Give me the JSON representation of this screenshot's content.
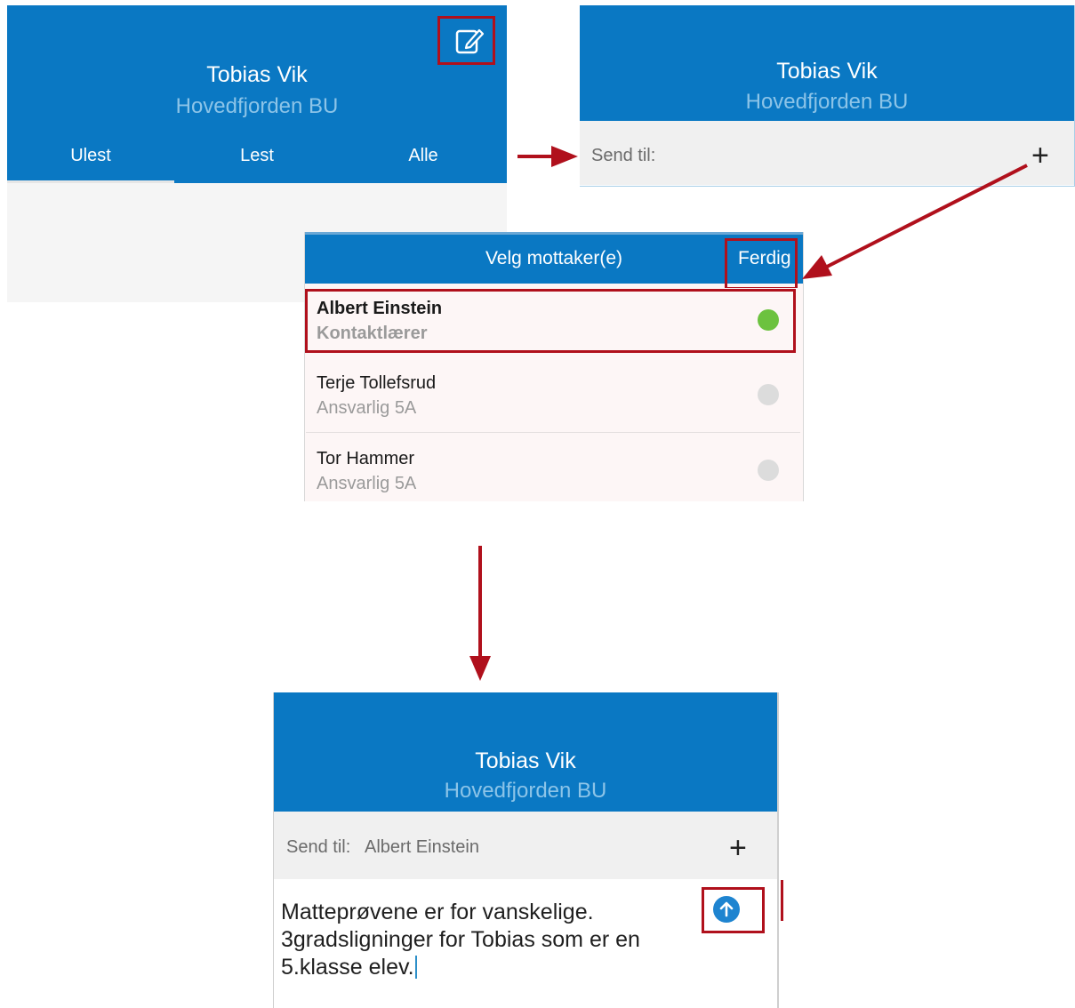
{
  "panel1": {
    "name": "Tobias Vik",
    "org": "Hovedfjorden BU",
    "tabs": [
      "Ulest",
      "Lest",
      "Alle"
    ],
    "compose_icon": "compose-icon"
  },
  "panel2": {
    "name": "Tobias Vik",
    "org": "Hovedfjorden BU",
    "send_label": "Send til:",
    "add_icon": "+"
  },
  "panel3": {
    "title": "Velg mottaker(e)",
    "done_label": "Ferdig",
    "recipients": [
      {
        "name": "Albert Einstein",
        "role": "Kontaktlærer",
        "selected": true
      },
      {
        "name": "Terje Tollefsrud",
        "role": "Ansvarlig 5A",
        "selected": false
      },
      {
        "name": "Tor Hammer",
        "role": "Ansvarlig 5A",
        "selected": false
      }
    ]
  },
  "panel4": {
    "name": "Tobias Vik",
    "org": "Hovedfjorden BU",
    "send_label": "Send til:",
    "recipient": "Albert Einstein",
    "add_icon": "+",
    "message_lines": [
      "Matteprøvene er for vanskelige.",
      "3gradsligninger for Tobias som er en",
      "5.klasse elev."
    ],
    "send_icon": "send-arrow-up-icon"
  },
  "colors": {
    "header_blue": "#0a78c3",
    "highlight_red": "#b0101c",
    "selected_green": "#6cc23f",
    "unselected_gray": "#dcdcdc"
  }
}
